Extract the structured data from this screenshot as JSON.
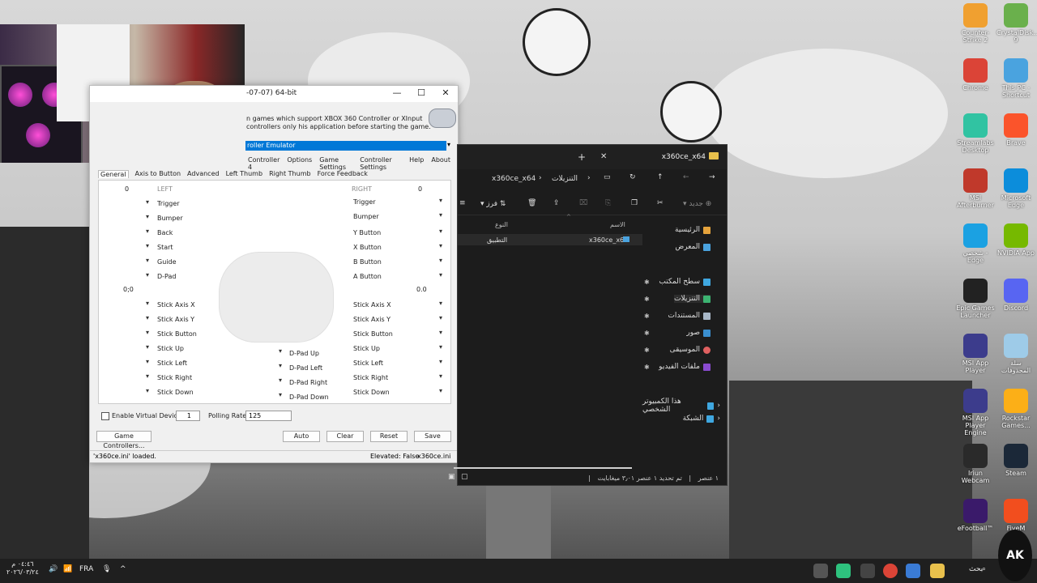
{
  "x360ce": {
    "title": "-07-07) 64-bit",
    "description": "n games which support XBOX 360 Controller or XInput controllers only his application before starting the game.",
    "selected_emulator": "roller Emulator",
    "menu": [
      "Controller 4",
      "Options",
      "Game Settings",
      "Controller Settings",
      "Help",
      "About"
    ],
    "tabs": [
      "General",
      "Axis to Button",
      "Advanced",
      "Left Thumb",
      "Right Thumb",
      "Force Feedback"
    ],
    "left_header": "LEFT",
    "right_header": "RIGHT",
    "left_trigger_value": "0",
    "right_trigger_value": "0",
    "left_stick_value": "0;0",
    "right_stick_value": "0.0",
    "left_labels": [
      "Trigger",
      "Bumper",
      "Back",
      "Start",
      "Guide",
      "D-Pad"
    ],
    "right_labels": [
      "Trigger",
      "Bumper",
      "Y Button",
      "X Button",
      "B Button",
      "A Button"
    ],
    "left_stick_labels": [
      "Stick Axis X",
      "Stick Axis Y",
      "Stick Button",
      "Stick Up",
      "Stick Left",
      "Stick Right",
      "Stick Down"
    ],
    "right_stick_labels": [
      "Stick Axis X",
      "Stick Axis Y",
      "Stick Button",
      "Stick Up",
      "Stick Left",
      "Stick Right",
      "Stick Down"
    ],
    "dpad_labels": [
      "D-Pad Up",
      "D-Pad Left",
      "D-Pad Right",
      "D-Pad Down"
    ],
    "enable_virtual_device": "Enable Virtual Device:",
    "virtual_device_value": "1",
    "polling_rate_label": "Polling Rate:",
    "polling_rate_value": "125",
    "game_controllers_button": "Game Controllers...",
    "auto_button": "Auto",
    "clear_button": "Clear",
    "reset_button": "Reset",
    "save_button": "Save",
    "status_loaded": "'x360ce.ini' loaded.",
    "status_elevated": "Elevated: False",
    "status_ini": "x360ce.ini"
  },
  "explorer": {
    "tab_title": "x360ce_x64",
    "path_parent": "التنزيلات",
    "path_current": "x360ce_x64",
    "new_label": "جديد",
    "sort_label": "فرز",
    "col_name": "الاسم",
    "col_type": "النوع",
    "row_name": "x360ce_x64",
    "row_type": "التطبيق",
    "nav": {
      "home": "الرئيسية",
      "gallery": "المعرض",
      "desktop": "سطح المكتب",
      "downloads": "التنزيلات",
      "documents": "المستندات",
      "pictures": "صور",
      "music": "الموسيقى",
      "videos": "ملفات الفيديو",
      "this_pc": "هذا الكمبيوتر الشخصي",
      "network": "الشبكة"
    },
    "status_items": "١ عنصر",
    "status_selected": "تم تحديد ١ عنصر ٣٫٠١ ميغابايت"
  },
  "desktop_icons": [
    {
      "label": "Counter-Strike 2",
      "color": "#f0a030"
    },
    {
      "label": "CrystalDisk... 9",
      "color": "#6ab04c"
    },
    {
      "label": "Chrome",
      "color": "#db4437"
    },
    {
      "label": "This PC - Shortcut",
      "color": "#4aa3df"
    },
    {
      "label": "Streamlabs Desktop",
      "color": "#31c3a2"
    },
    {
      "label": "Brave",
      "color": "#fb542b"
    },
    {
      "label": "MSI Afterburner",
      "color": "#c0392b"
    },
    {
      "label": "Microsoft Edge",
      "color": "#0c8ddb"
    },
    {
      "label": "شخصي - Edge",
      "color": "#1ba1e2"
    },
    {
      "label": "NVIDIA App",
      "color": "#76b900"
    },
    {
      "label": "Epic Games Launcher",
      "color": "#222222"
    },
    {
      "label": "Discord",
      "color": "#5865f2"
    },
    {
      "label": "MSI App Player",
      "color": "#3c3c8c"
    },
    {
      "label": "سلة المحذوفات",
      "color": "#9ecbe8"
    },
    {
      "label": "MSI App Player Engine",
      "color": "#3c3c8c"
    },
    {
      "label": "Rockstar Games...",
      "color": "#fcaf17"
    },
    {
      "label": "Iriun Webcam",
      "color": "#2a2a2a"
    },
    {
      "label": "Steam",
      "color": "#1b2838"
    },
    {
      "label": "eFootball™",
      "color": "#3a1a6a"
    },
    {
      "label": "FiveM",
      "color": "#f24e1e"
    }
  ],
  "taskbar": {
    "time": "٠٤:٤٦ م",
    "date": "٢٠٢٦/٠٣/٢٤",
    "language": "FRA",
    "search_label": "بحث",
    "watermark": "AK"
  }
}
